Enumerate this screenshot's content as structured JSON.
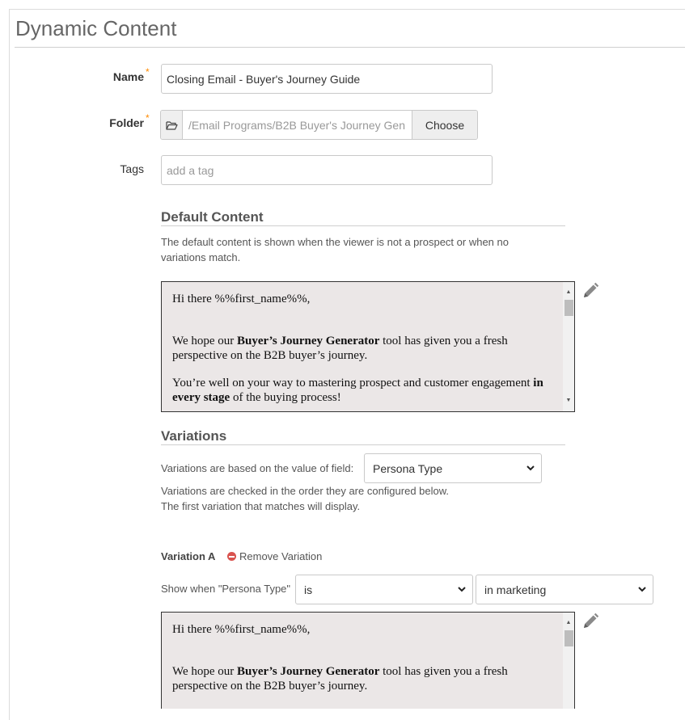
{
  "page": {
    "title": "Dynamic Content"
  },
  "form": {
    "name_label": "Name",
    "name_value": "Closing Email - Buyer's Journey Guide",
    "folder_label": "Folder",
    "folder_path": "/Email Programs/B2B Buyer's Journey Gen",
    "choose_label": "Choose",
    "tags_label": "Tags",
    "tags_placeholder": "add a tag",
    "required_marker": "*"
  },
  "default_content": {
    "title": "Default Content",
    "help_line1": "The default content is shown when the viewer is not a prospect or when no",
    "help_line2": "variations match.",
    "editor": {
      "greeting": "Hi there %%first_name%%,",
      "p2_pre": "We hope our ",
      "p2_bold": "Buyer’s Journey Generator",
      "p2_post": " tool has given you a fresh perspective on the B2B buyer’s journey.",
      "p3_pre": "You’re well on your way to mastering prospect and customer engagement ",
      "p3_bold": "in every stage",
      "p3_post": " of the buying process!"
    }
  },
  "variations": {
    "title": "Variations",
    "field_label": "Variations are based on the value of field:",
    "field_value": "Persona Type",
    "help_line1": "Variations are checked in the order they are configured below.",
    "help_line2": "The first variation that matches will display.",
    "items": [
      {
        "label": "Variation A",
        "remove_label": "Remove Variation",
        "condition_label": "Show when \"Persona Type\"",
        "operator": "is",
        "value": "in marketing",
        "editor": {
          "greeting": "Hi there %%first_name%%,",
          "p2_pre": "We hope our ",
          "p2_bold": "Buyer’s Journey Generator",
          "p2_post": " tool has given you a fresh perspective on the B2B buyer’s journey."
        }
      }
    ]
  },
  "icons": {
    "folder": "folder-open-icon",
    "edit": "pencil-icon",
    "remove": "minus-circle-icon",
    "dropdown": "chevron-down-icon"
  },
  "colors": {
    "required": "#ff8a00",
    "remove": "#d9534f",
    "editor_bg": "#ebe7e7",
    "title": "#666666"
  }
}
